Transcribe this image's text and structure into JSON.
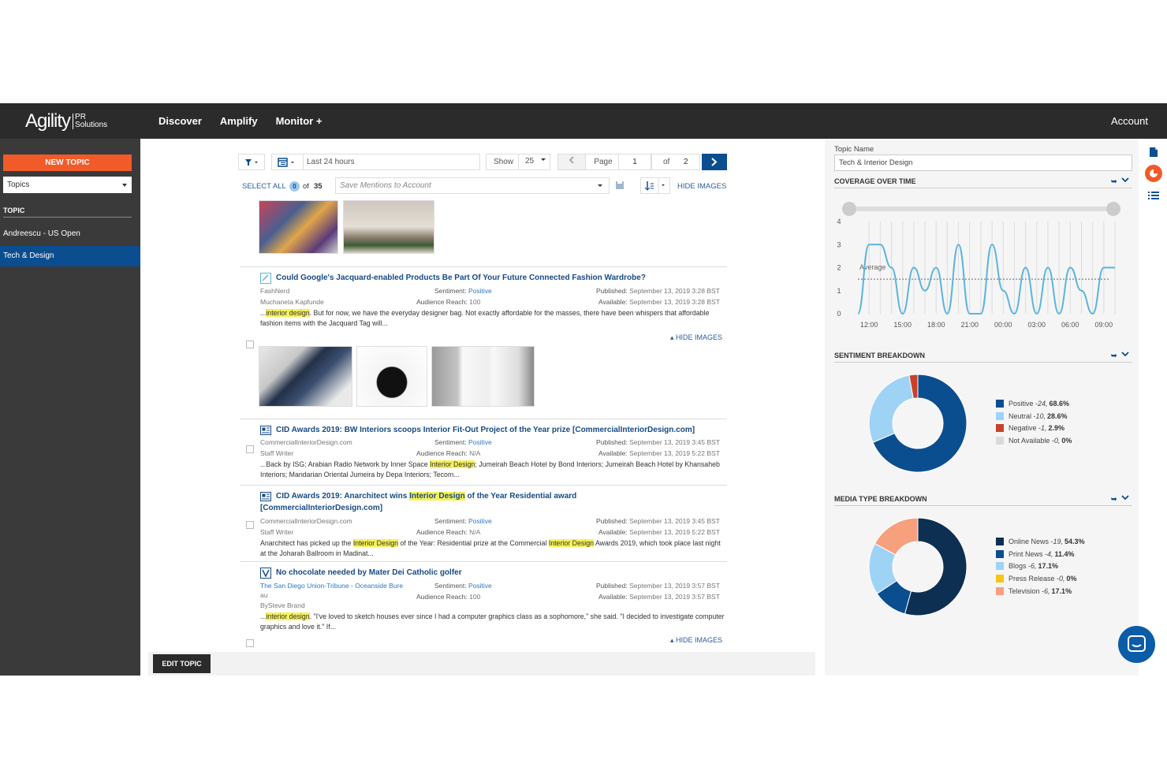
{
  "nav": {
    "logo_main": "Agility",
    "logo_sub1": "PR",
    "logo_sub2": "Solutions",
    "links": [
      "Discover",
      "Amplify",
      "Monitor +"
    ],
    "account": "Account"
  },
  "sidebar": {
    "new_topic": "NEW TOPIC",
    "topics_select": "Topics",
    "topic_header": "TOPIC",
    "items": [
      {
        "label": "Andreescu - US Open",
        "active": false
      },
      {
        "label": "Tech & Design",
        "active": true
      }
    ],
    "edit_topic": "EDIT TOPIC"
  },
  "toolbar": {
    "date_range": "Last 24 hours",
    "show_label": "Show",
    "show_value": "25",
    "page_label": "Page",
    "page_value": "1",
    "of_label": "of",
    "total_pages": "2",
    "select_all": "SELECT ALL",
    "selected_count": "0",
    "of_total": "of",
    "total_count": "35",
    "save_placeholder": "Save Mentions to Account",
    "hide_images": "HIDE IMAGES"
  },
  "articles": [
    {
      "title": "Could Google's Jacquard-enabled Products Be Part Of Your Future Connected Fashion Wardrobe?",
      "source": "FashNerd",
      "author": "Muchaneta Kapfunde",
      "sentiment_label": "Sentiment:",
      "sentiment": "Positive",
      "reach_label": "Audience Reach:",
      "reach": "100",
      "published_label": "Published:",
      "published": "September 13, 2019 3:28 BST",
      "available_label": "Available:",
      "available": "September 13, 2019 3:28 BST",
      "snippet_pre": "...",
      "snippet_hl": "interior design",
      "snippet_post": ". But for now, we have the everyday designer bag. Not exactly affordable for the masses, there have been whispers that affordable fashion items with the Jacquard Tag will...",
      "hide_images": "HIDE IMAGES"
    },
    {
      "title": "CID Awards 2019: BW Interiors scoops Interior Fit-Out Project of the Year prize [CommercialInteriorDesign.com]",
      "source": "CommercialInteriorDesign.com",
      "author": "Staff Writer",
      "sentiment_label": "Sentiment:",
      "sentiment": "Positive",
      "reach_label": "Audience Reach:",
      "reach": "N/A",
      "published_label": "Published:",
      "published": "September 13, 2019 3:45 BST",
      "available_label": "Available:",
      "available": "September 13, 2019 5:22 BST",
      "snippet_pre": "...Back by ISG; Arabian Radio Network by Inner Space ",
      "snippet_hl": "Interior Design",
      "snippet_post": "; Jumeirah Beach Hotel by Bond Interiors; Jumeirah Beach Hotel by Khansaheb Interiors; Mandarian Oriental Jumeira by Depa Interiors; Tecom..."
    },
    {
      "title_pre": "CID Awards 2019: Anarchitect wins ",
      "title_hl": "Interior Design",
      "title_post": " of the Year Residential award",
      "title_line2": "[CommercialInteriorDesign.com]",
      "source": "CommercialInteriorDesign.com",
      "author": "Staff Writer",
      "sentiment_label": "Sentiment:",
      "sentiment": "Positive",
      "reach_label": "Audience Reach:",
      "reach": "N/A",
      "published_label": "Published:",
      "published": "September 13, 2019 3:45 BST",
      "available_label": "Available:",
      "available": "September 13, 2019 5:22 BST",
      "snippet_pre": "Anarchitect has picked up the ",
      "snippet_hl": "Interior Design",
      "snippet_mid": " of the Year: Residential prize at the Commercial ",
      "snippet_hl2": "Interior Design",
      "snippet_post": " Awards 2019, which took place last night at the Joharah Ballroom in Madinat..."
    },
    {
      "title": "No chocolate needed by Mater Dei Catholic golfer",
      "source": "The San Diego Union-Tribune - Oceanside Bure",
      "source2": "au",
      "author": "BySteve Brand",
      "sentiment_label": "Sentiment:",
      "sentiment": "Positive",
      "reach_label": "Audience Reach:",
      "reach": "100",
      "published_label": "Published:",
      "published": "September 13, 2019 3:57 BST",
      "available_label": "Available:",
      "available": "September 13, 2019 3:57 BST",
      "snippet_pre": "...",
      "snippet_hl": "interior design",
      "snippet_post": ". \"I've loved to sketch houses ever since I had a computer graphics class as a sophomore,\" she said. \"I decided to investigate computer graphics and love it.\" If...",
      "hide_images": "HIDE IMAGES"
    }
  ],
  "right": {
    "topic_name_label": "Topic Name",
    "topic_name": "Tech & Interior Design",
    "coverage_title": "COVERAGE OVER TIME",
    "sentiment_title": "SENTIMENT BREAKDOWN",
    "media_title": "MEDIA TYPE BREAKDOWN"
  },
  "chart_data": [
    {
      "type": "line",
      "title": "COVERAGE OVER TIME",
      "x": [
        "11:00",
        "12:00",
        "13:00",
        "14:00",
        "15:00",
        "16:00",
        "17:00",
        "18:00",
        "19:00",
        "20:00",
        "21:00",
        "22:00",
        "23:00",
        "00:00",
        "01:00",
        "02:00",
        "03:00",
        "04:00",
        "05:00",
        "06:00",
        "07:00",
        "08:00",
        "09:00",
        "10:00"
      ],
      "tick_labels": [
        "12:00",
        "15:00",
        "18:00",
        "21:00",
        "00:00",
        "03:00",
        "06:00",
        "09:00"
      ],
      "values": [
        0,
        3,
        3,
        2,
        0,
        2,
        1,
        2,
        0,
        3,
        0,
        0,
        3,
        1,
        0,
        2,
        0,
        2,
        0,
        2,
        1,
        0,
        2,
        2
      ],
      "ylim": [
        0,
        4
      ],
      "yticks": [
        "0",
        "1",
        "2",
        "3",
        "4"
      ],
      "average_label": "Average",
      "average": 1.5,
      "color": "#5bb4dc"
    },
    {
      "type": "pie",
      "title": "SENTIMENT BREAKDOWN",
      "series": [
        {
          "name": "Positive",
          "count": "24",
          "pct": "68.6%",
          "value": 24,
          "color": "#0b4e8f"
        },
        {
          "name": "Neutral",
          "count": "10",
          "pct": "28.6%",
          "value": 10,
          "color": "#9fd3f5"
        },
        {
          "name": "Negative",
          "count": "1",
          "pct": "2.9%",
          "value": 1,
          "color": "#c8412b"
        },
        {
          "name": "Not Available",
          "count": "0",
          "pct": "0%",
          "value": 0,
          "color": "#d9d9d9"
        }
      ]
    },
    {
      "type": "pie",
      "title": "MEDIA TYPE BREAKDOWN",
      "series": [
        {
          "name": "Online News",
          "count": "19",
          "pct": "54.3%",
          "value": 19,
          "color": "#0d2f52"
        },
        {
          "name": "Print News",
          "count": "4",
          "pct": "11.4%",
          "value": 4,
          "color": "#0b4e8f"
        },
        {
          "name": "Blogs",
          "count": "6",
          "pct": "17.1%",
          "value": 6,
          "color": "#9fd3f5"
        },
        {
          "name": "Press Release",
          "count": "0",
          "pct": "0%",
          "value": 0,
          "color": "#f5c518"
        },
        {
          "name": "Television",
          "count": "6",
          "pct": "17.1%",
          "value": 6,
          "color": "#f7a07e"
        }
      ]
    }
  ]
}
